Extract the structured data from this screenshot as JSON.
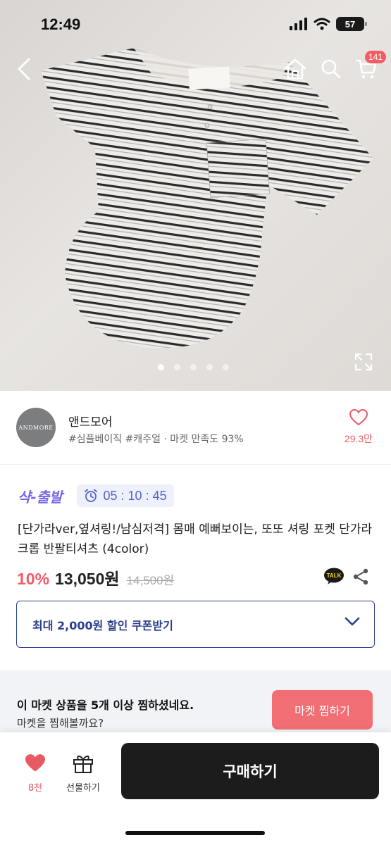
{
  "status_bar": {
    "time": "12:49",
    "battery": "57"
  },
  "header": {
    "cart_count": "141"
  },
  "gallery": {
    "total_images": 5,
    "active_index": 0
  },
  "seller": {
    "avatar_text": "ANDMORE",
    "name": "앤드모어",
    "tags": "#심플베이직 #캐주얼 · 마켓 만족도 93%",
    "like_count": "29.3만"
  },
  "product": {
    "promo_label": "샥-출발",
    "timer": "05 : 10 : 45",
    "title": "[단가라ver,옆셔링!/남심저격] 몸매 예뻐보이는, 또또 셔링 포켓 단가라 크롭 반팔티셔츠 (4color)",
    "discount": "10%",
    "price": "13,050원",
    "original_price": "14,500원",
    "talk_label": "TALK"
  },
  "coupon": {
    "label": "최대 2,000원 할인 쿠폰받기"
  },
  "banner": {
    "title": "이 마켓 상품을 5개 이상 찜하셨네요.",
    "subtitle": "마켓을 찜해볼까요?",
    "button": "마켓 찜하기"
  },
  "bottom_bar": {
    "like_count": "8천",
    "gift_label": "선물하기",
    "buy_label": "구매하기"
  },
  "colors": {
    "accent_red": "#f25c66",
    "coupon_blue": "#2c3f8f",
    "buy_button": "#1c1c1c"
  }
}
